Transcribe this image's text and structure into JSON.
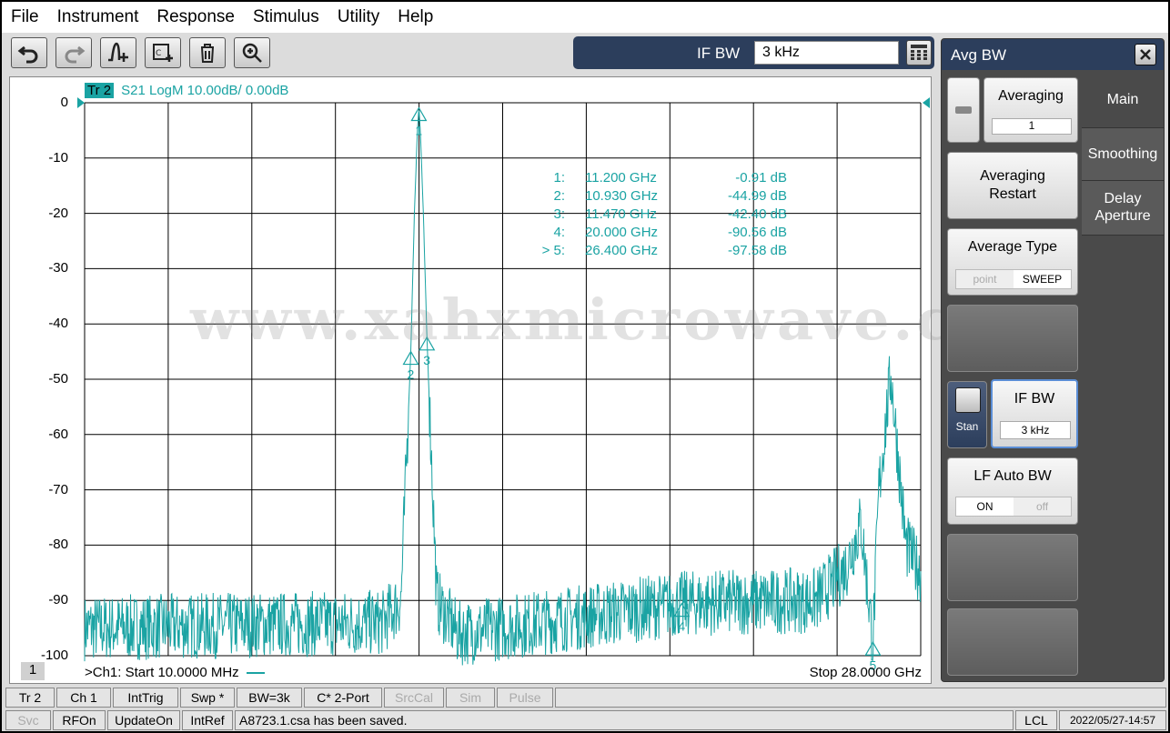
{
  "menu": [
    "File",
    "Instrument",
    "Response",
    "Stimulus",
    "Utility",
    "Help"
  ],
  "toolbar": {
    "buttons": [
      "undo-icon",
      "redo-icon",
      "add-marker-icon",
      "add-channel-icon",
      "delete-icon",
      "zoom-icon"
    ],
    "ifbw_label": "IF BW",
    "ifbw_value": "3 kHz"
  },
  "trace": {
    "tag": "Tr 2",
    "header": "S21 LogM 10.00dB/  0.00dB",
    "color": "#1aa3a3"
  },
  "axis": {
    "y_ticks": [
      "0",
      "-10",
      "-20",
      "-30",
      "-40",
      "-50",
      "-60",
      "-70",
      "-80",
      "-90",
      "-100"
    ],
    "ylim": [
      -100,
      0
    ],
    "channel_badge": "1",
    "start_label": ">Ch1:  Start  10.0000 MHz",
    "stop_label": "Stop  28.0000 GHz"
  },
  "markers": [
    {
      "id": "1:",
      "freq": "11.200  GHz",
      "value": "-0.91 dB"
    },
    {
      "id": "2:",
      "freq": "10.930  GHz",
      "value": "-44.99 dB"
    },
    {
      "id": "3:",
      "freq": "11.470  GHz",
      "value": "-42.40 dB"
    },
    {
      "id": "4:",
      "freq": "20.000  GHz",
      "value": "-90.56 dB"
    },
    {
      "id": "> 5:",
      "freq": "26.400  GHz",
      "value": "-97.58 dB"
    }
  ],
  "marker_labels": [
    "1",
    "2",
    "3",
    "4",
    "5"
  ],
  "watermark": "www.xahxmicrowave.com",
  "panel": {
    "title": "Avg BW",
    "averaging": {
      "label": "Averaging",
      "value": "1"
    },
    "averaging_restart": "Averaging Restart",
    "average_type": {
      "label": "Average Type",
      "options": [
        "point",
        "SWEEP"
      ],
      "selected": "SWEEP"
    },
    "stan_label": "Stan",
    "ifbw": {
      "label": "IF BW",
      "value": "3 kHz"
    },
    "lf_auto_bw": {
      "label": "LF Auto BW",
      "options": [
        "ON",
        "off"
      ],
      "selected": "ON"
    },
    "tabs": [
      "Main",
      "Smoothing",
      "Delay Aperture"
    ]
  },
  "status_row1": [
    "Tr 2",
    "Ch 1",
    "IntTrig",
    "Swp *",
    "BW=3k",
    "C* 2-Port",
    "SrcCal",
    "Sim",
    "Pulse"
  ],
  "status_row2": {
    "items": [
      "Svc",
      "RFOn",
      "UpdateOn",
      "IntRef"
    ],
    "message": "A8723.1.csa has been saved.",
    "lcl": "LCL",
    "datetime": "2022/05/27-14:57"
  },
  "chart_data": {
    "type": "line",
    "title": "S21 LogM 10.00dB/  0.00dB",
    "xlabel": "",
    "ylabel": "",
    "x_range_ghz": [
      0.01,
      28.0
    ],
    "ylim": [
      -100,
      0
    ],
    "y_unit": "dB",
    "grid": true,
    "series": [
      {
        "name": "",
        "color": "#1aa3a3",
        "x": [
          0.01,
          10.0,
          10.6,
          10.93,
          11.05,
          11.15,
          11.2,
          11.25,
          11.35,
          11.47,
          11.8,
          12.5,
          20.0,
          24.5,
          25.5,
          26.0,
          26.4,
          26.6,
          27.0,
          27.5,
          28.0
        ],
        "y": [
          -95,
          -94,
          -90,
          -44.99,
          -20,
          -5,
          -0.91,
          -5,
          -20,
          -42.4,
          -90,
          -96,
          -90.56,
          -90,
          -84,
          -76,
          -97.58,
          -70,
          -49,
          -80,
          -85
        ]
      }
    ]
  }
}
